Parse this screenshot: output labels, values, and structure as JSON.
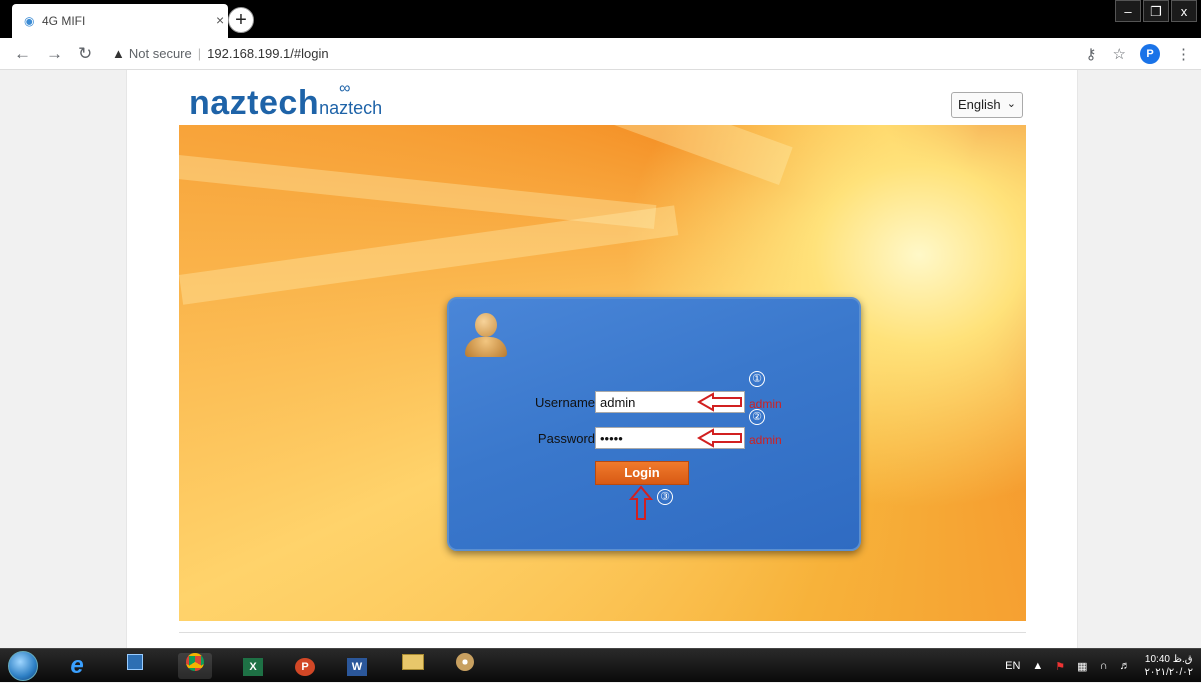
{
  "browser": {
    "tab_title": "4G MIFI",
    "tab_close": "×",
    "new_tab": "+",
    "window_controls": [
      "–",
      "❐",
      "x"
    ],
    "not_secure": "Not secure",
    "url": "192.168.199.1/#login",
    "profile_initial": "P"
  },
  "page": {
    "logo_main": "naztech",
    "logo_sub": "naztech",
    "language_selected": "English"
  },
  "login": {
    "username_label": "Username",
    "username_value": "admin",
    "password_label": "Password",
    "password_value": "•••••",
    "login_button": "Login",
    "annotations": {
      "step1": "①",
      "step2": "②",
      "step3": "③",
      "username_hint": "admin",
      "password_hint": "admin"
    }
  },
  "taskbar": {
    "lang": "EN",
    "time": "10:40 ق.ظ",
    "date": "۲۰۲۱/۲۰/۰۲"
  },
  "colors": {
    "accent_blue": "#1e63a8",
    "login_button": "#e8681f",
    "annotation_red": "#d12020"
  }
}
